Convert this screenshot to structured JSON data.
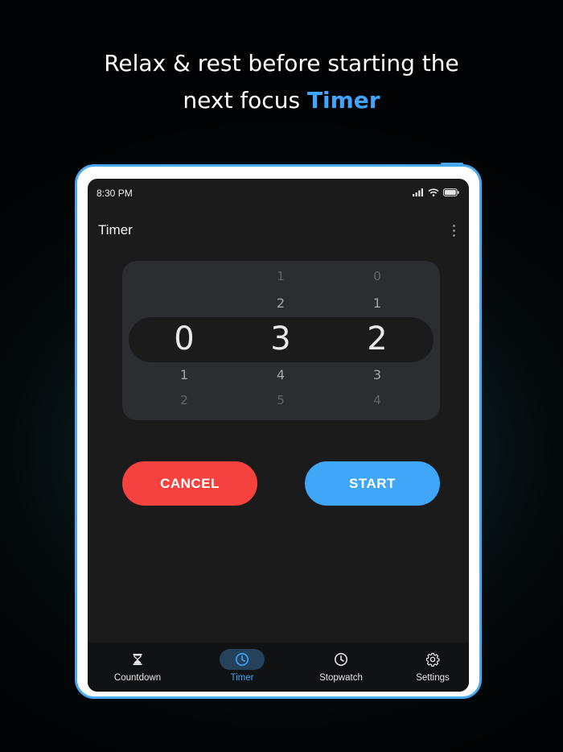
{
  "headline": {
    "line1": "Relax & rest before starting the",
    "line2_prefix": "next focus ",
    "line2_accent": "Timer"
  },
  "status_bar": {
    "time": "8:30 PM",
    "icons": [
      "signal-icon",
      "wifi-icon",
      "battery-icon"
    ]
  },
  "app_bar": {
    "title": "Timer",
    "menu_icon": "more-vert-icon"
  },
  "picker": {
    "hours": {
      "far_above": "",
      "above": "",
      "selected": "0",
      "below": "1",
      "far_below": "2"
    },
    "minutes": {
      "far_above": "1",
      "above": "2",
      "selected": "3",
      "below": "4",
      "far_below": "5"
    },
    "seconds": {
      "far_above": "0",
      "above": "1",
      "selected": "2",
      "below": "3",
      "far_below": "4"
    }
  },
  "buttons": {
    "cancel": "CANCEL",
    "start": "START"
  },
  "bottom_nav": [
    {
      "label": "Countdown",
      "icon": "hourglass-icon",
      "active": false
    },
    {
      "label": "Timer",
      "icon": "clock-icon",
      "active": true
    },
    {
      "label": "Stopwatch",
      "icon": "clock-icon",
      "active": false
    },
    {
      "label": "Settings",
      "icon": "gear-icon",
      "active": false
    }
  ],
  "colors": {
    "accent": "#3ea6ff",
    "cancel": "#f5423f",
    "start": "#3fa6f8",
    "frame": "#4aa8ee",
    "screen": "#1b1b1c"
  }
}
